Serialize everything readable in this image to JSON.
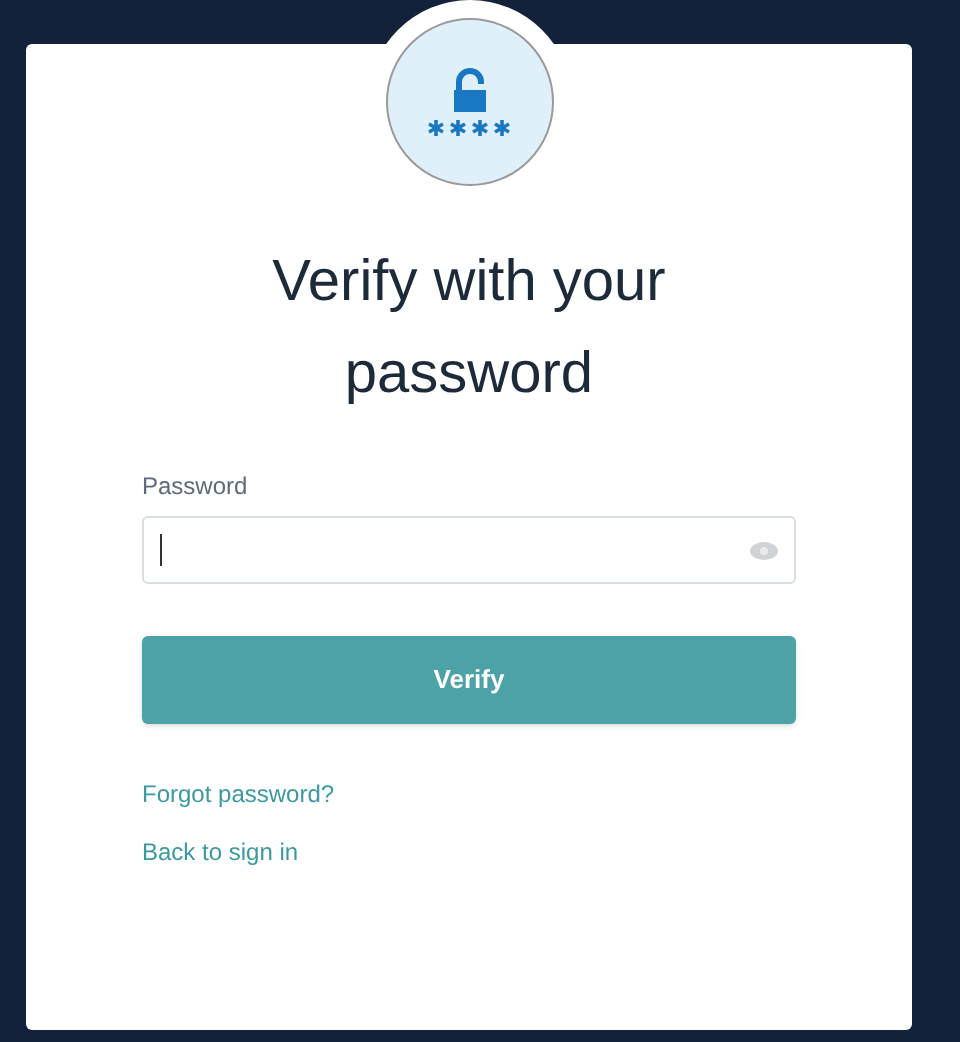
{
  "title_lines": [
    "Verify with your",
    "password"
  ],
  "password": {
    "label": "Password"
  },
  "verify_button": "Verify",
  "links": [
    "Forgot password?",
    "Back to sign in"
  ]
}
